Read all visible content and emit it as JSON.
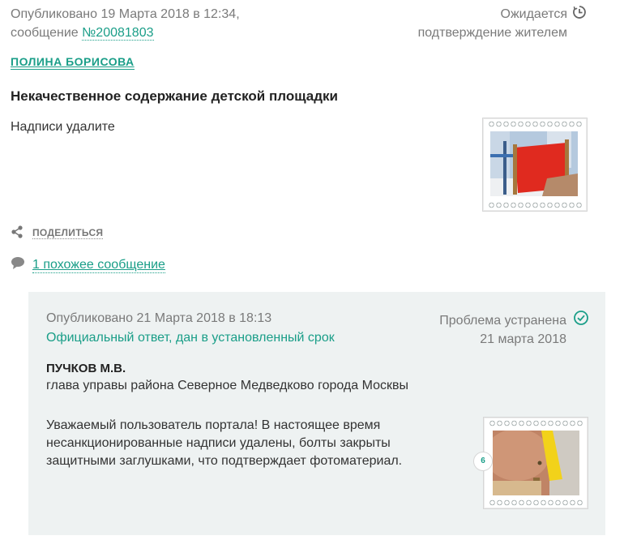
{
  "complaint": {
    "published_label": "Опубликовано 19 Марта 2018 в 12:34,",
    "message_prefix": "сообщение ",
    "message_number": "№20081803",
    "status_line1": "Ожидается",
    "status_line2": "подтверждение жителем",
    "author": "ПОЛИНА БОРИСОВА",
    "title": "Некачественное содержание детской площадки",
    "text": "Надписи удалите"
  },
  "actions": {
    "share_label": "ПОДЕЛИТЬСЯ",
    "similar_label": "1 похожее сообщение"
  },
  "answer": {
    "published_label": "Опубликовано 21 Марта 2018 в 18:13",
    "official_label": "Официальный ответ, дан в установленный срок",
    "status_line1": "Проблема устранена",
    "status_line2": "21 марта 2018",
    "official_name": "ПУЧКОВ М.В.",
    "official_position": "глава управы района Северное Медведково города Москвы",
    "text_line1": "Уважаемый пользователь портала! В настоящее время",
    "text_line2": "несанкционированные надписи удалены, болты закрыты",
    "text_line3": "защитными заглушками, что подтверждает фотоматериал.",
    "photo_count": "6"
  },
  "colors": {
    "accent": "#1a9e88",
    "muted_text": "#7a7a7a",
    "answer_background": "#eef2f2"
  },
  "icons": {
    "status_pending": "clock-icon",
    "status_resolved": "check-circle-icon",
    "share": "share-icon",
    "similar": "speech-bubble-icon"
  }
}
